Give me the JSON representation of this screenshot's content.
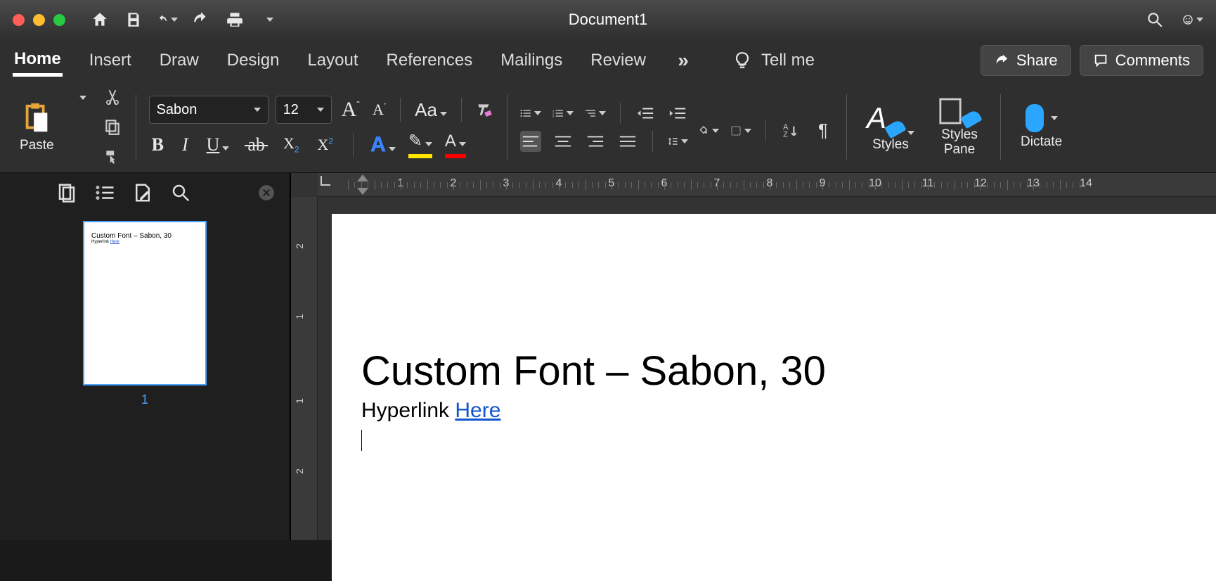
{
  "window": {
    "title": "Document1"
  },
  "tabs": {
    "items": [
      "Home",
      "Insert",
      "Draw",
      "Design",
      "Layout",
      "References",
      "Mailings",
      "Review"
    ],
    "tellme": "Tell me",
    "share": "Share",
    "comments": "Comments"
  },
  "ribbon": {
    "paste": "Paste",
    "font_name": "Sabon",
    "font_size": "12",
    "case_label": "Aa",
    "styles": "Styles",
    "styles_pane_l1": "Styles",
    "styles_pane_l2": "Pane",
    "dictate": "Dictate"
  },
  "ruler": {
    "h": [
      "1",
      "2",
      "3",
      "4",
      "5",
      "6",
      "7",
      "8",
      "9",
      "10",
      "11",
      "12",
      "13",
      "14"
    ],
    "v": [
      "2",
      "1",
      "1",
      "2"
    ]
  },
  "sidebar": {
    "thumb_line1": "Custom Font – Sabon, 30",
    "thumb_line2a": "Hyperlink ",
    "thumb_line2b": "Here",
    "page_number": "1"
  },
  "document": {
    "heading": "Custom Font – Sabon, 30",
    "line2_text": "Hyperlink ",
    "line2_link": "Here"
  }
}
